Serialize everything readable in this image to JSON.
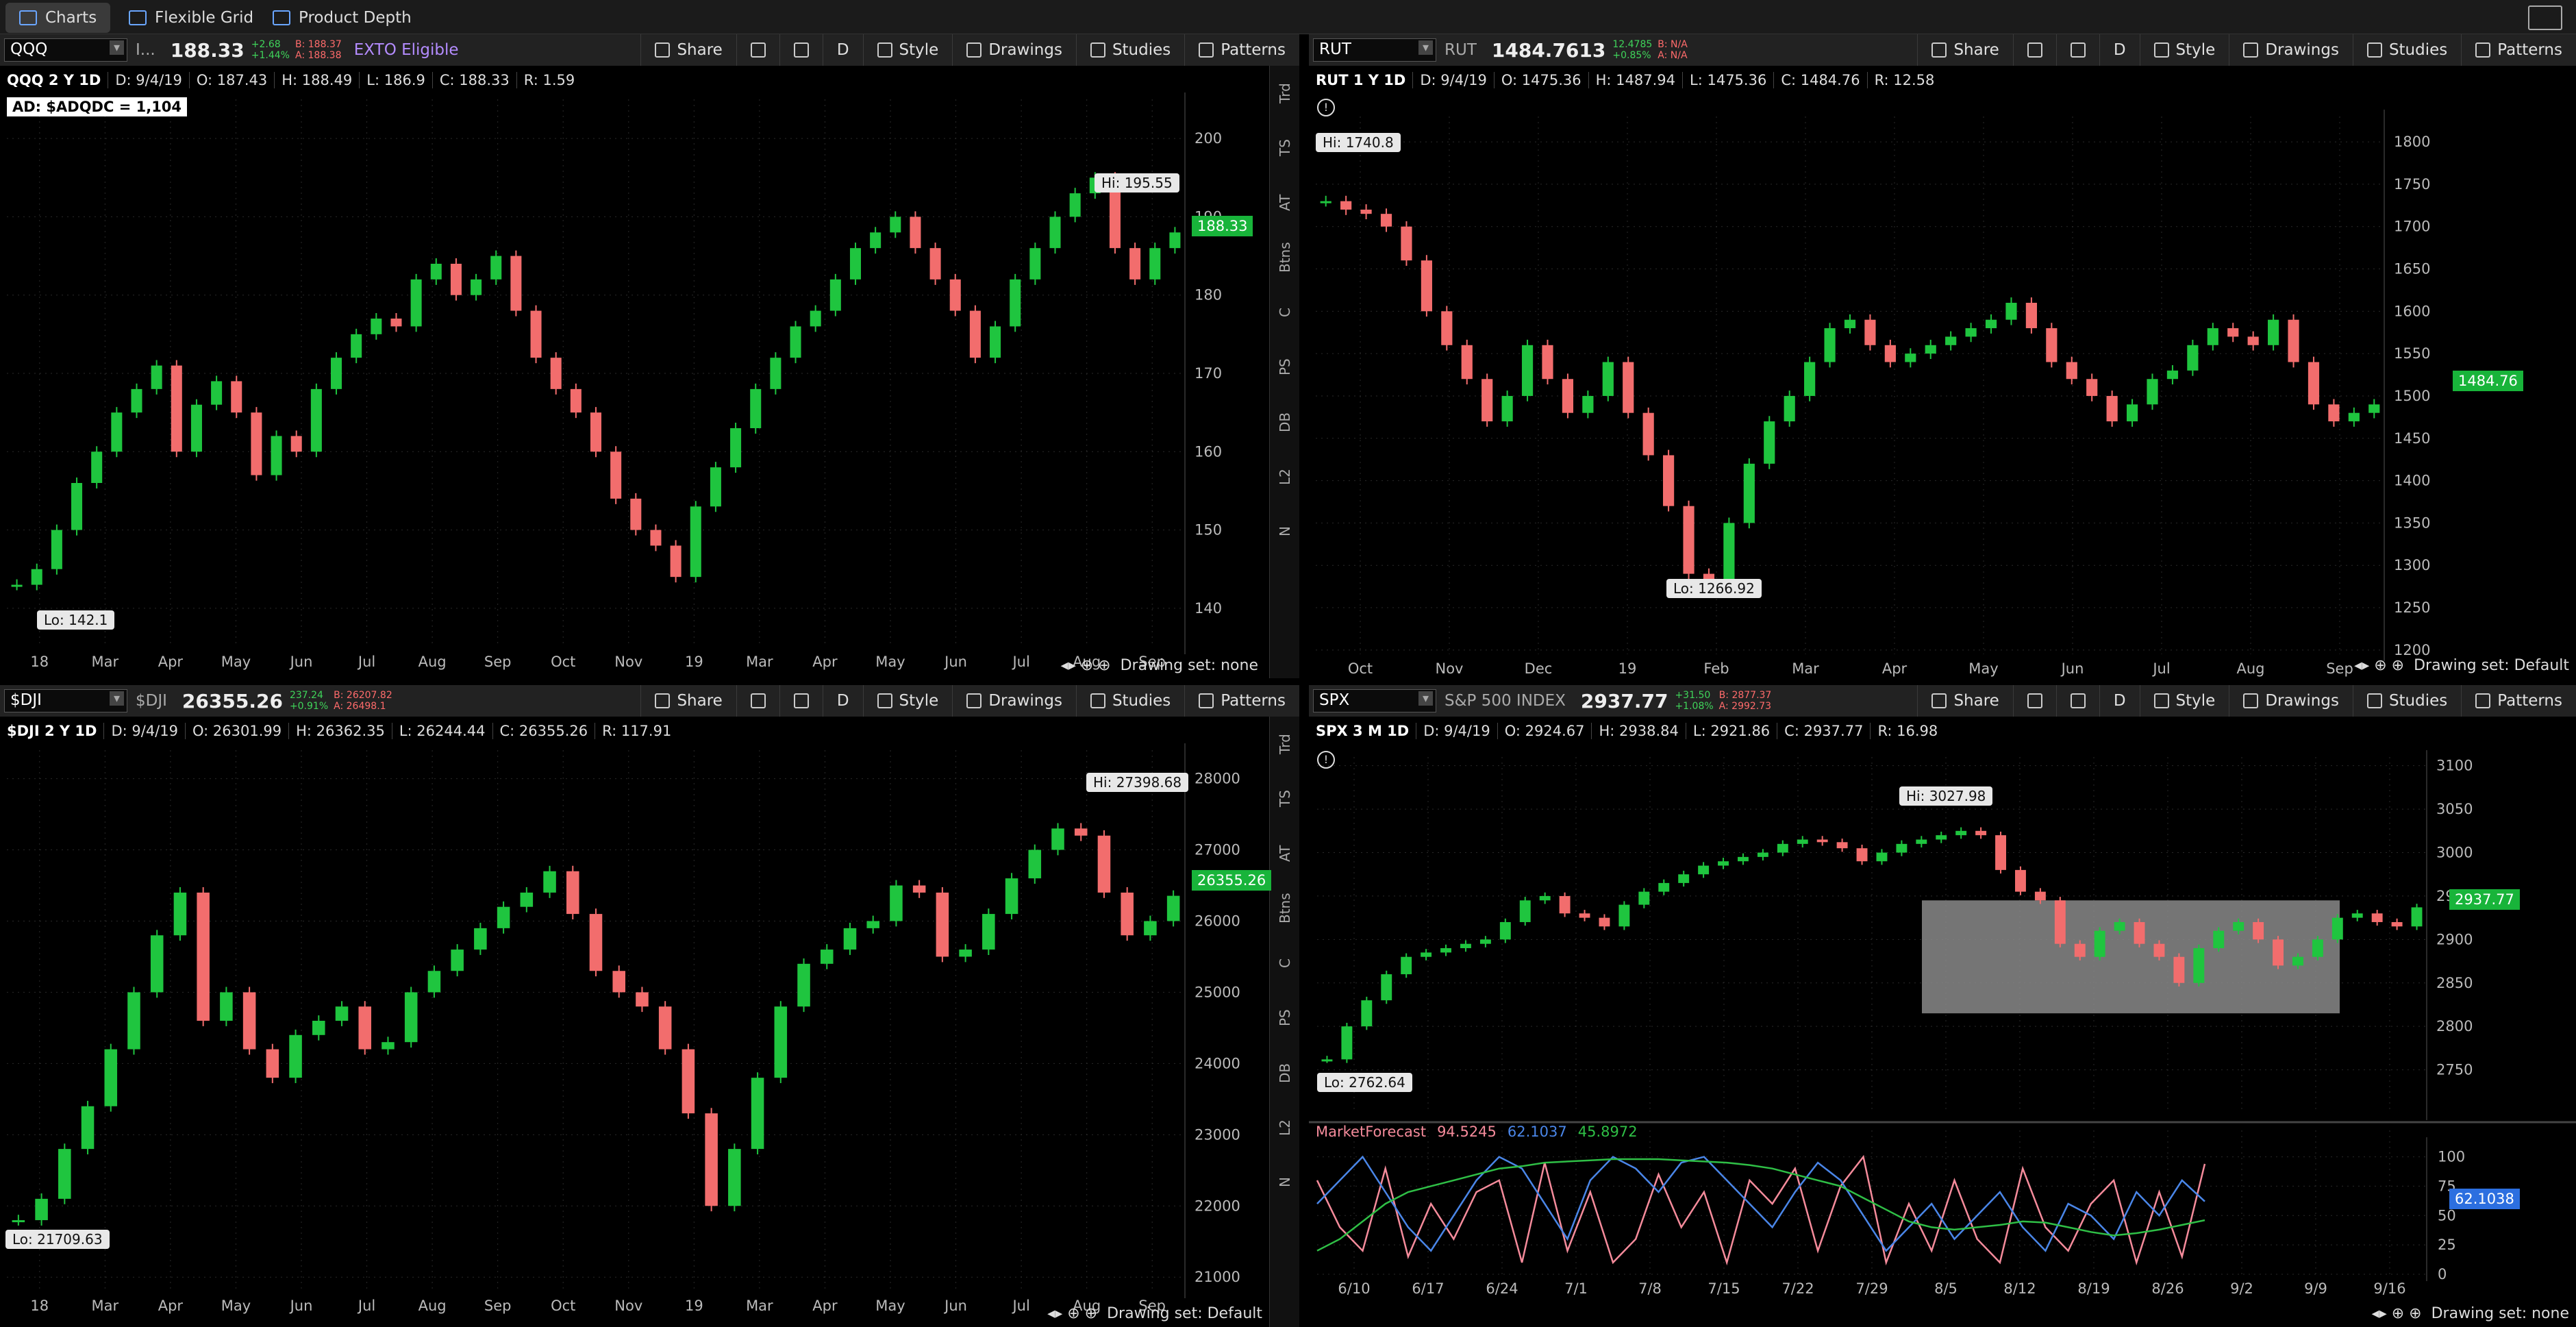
{
  "app": {
    "tabs": [
      {
        "label": "Charts",
        "icon": "chart-icon"
      },
      {
        "label": "Flexible Grid",
        "icon": "grid-icon"
      },
      {
        "label": "Product Depth",
        "icon": "depth-icon"
      }
    ]
  },
  "toolbar_labels": {
    "share": "Share",
    "style": "Style",
    "drawings": "Drawings",
    "studies": "Studies",
    "patterns": "Patterns",
    "period": "D"
  },
  "side_buttons": [
    "Trd",
    "TS",
    "AT",
    "Btns",
    "C",
    "PS",
    "DB",
    "L2",
    "N"
  ],
  "panels": [
    {
      "id": "qqq",
      "symbol": "QQQ",
      "desc": "I...",
      "last": "188.33",
      "chg": "+2.68",
      "chg_pct": "+1.44%",
      "bid": "B: 188.37",
      "ask": "A: 188.38",
      "exto": "EXTO Eligible",
      "title": "QQQ 2 Y 1D",
      "date": "D: 9/4/19",
      "open": "O: 187.43",
      "high": "H: 188.49",
      "low": "L: 186.9",
      "close": "C: 188.33",
      "range": "R: 1.59",
      "ad_label": "AD: $ADQDC = 1,104",
      "hi_label": "Hi: 195.55",
      "lo_label": "Lo: 142.1",
      "price_box": "188.33",
      "drawing_set": "Drawing set: none"
    },
    {
      "id": "rut",
      "symbol": "RUT",
      "desc": "RUT",
      "last": "1484.7613",
      "chg": "12.4785",
      "chg_pct": "+0.85%",
      "bid": "B: N/A",
      "ask": "A: N/A",
      "title": "RUT 1 Y 1D",
      "date": "D: 9/4/19",
      "open": "O: 1475.36",
      "high": "H: 1487.94",
      "low": "L: 1475.36",
      "close": "C: 1484.76",
      "range": "R: 12.58",
      "hi_label": "Hi: 1740.8",
      "lo_label": "Lo: 1266.92",
      "price_box": "1484.76",
      "drawing_set": "Drawing set: Default"
    },
    {
      "id": "dji",
      "symbol": "$DJI",
      "desc": "$DJI",
      "last": "26355.26",
      "chg": "237.24",
      "chg_pct": "+0.91%",
      "bid": "B: 26207.82",
      "ask": "A: 26498.1",
      "title": "$DJI 2 Y 1D",
      "date": "D: 9/4/19",
      "open": "O: 26301.99",
      "high": "H: 26362.35",
      "low": "L: 26244.44",
      "close": "C: 26355.26",
      "range": "R: 117.91",
      "hi_label": "Hi: 27398.68",
      "lo_label": "Lo: 21709.63",
      "price_box": "26355.26",
      "drawing_set": "Drawing set: Default"
    },
    {
      "id": "spx",
      "symbol": "SPX",
      "desc": "S&P 500 INDEX",
      "last": "2937.77",
      "chg": "+31.50",
      "chg_pct": "+1.08%",
      "bid": "B: 2877.37",
      "ask": "A: 2992.73",
      "title": "SPX 3 M 1D",
      "date": "D: 9/4/19",
      "open": "O: 2924.67",
      "high": "H: 2938.84",
      "low": "L: 2921.86",
      "close": "C: 2937.77",
      "range": "R: 16.98",
      "hi_label": "Hi: 3027.98",
      "lo_label": "Lo: 2762.64",
      "price_box": "2937.77",
      "drawing_set": "Drawing set: none",
      "study_name": "MarketForecast",
      "study_v1": "94.5245",
      "study_v2": "62.1037",
      "study_v3": "45.8972",
      "study_box": "62.1038"
    }
  ],
  "colors": {
    "up": "#1fc53f",
    "down": "#f26d6d",
    "bg": "#000000",
    "toolbar": "#222222",
    "accent": "#18b43a"
  },
  "chart_data": [
    {
      "type": "candlestick",
      "title": "QQQ 2 Y 1D",
      "x": [
        "18",
        "Mar",
        "Apr",
        "May",
        "Jun",
        "Jul",
        "Aug",
        "Sep",
        "Oct",
        "Nov",
        "19",
        "Mar",
        "Apr",
        "May",
        "Jun",
        "Jul",
        "Aug",
        "Sep"
      ],
      "ylim": [
        135,
        205
      ],
      "yticks": [
        140,
        150,
        160,
        170,
        180,
        190,
        200
      ],
      "series": [
        {
          "values": [
            143,
            145,
            150,
            156,
            160,
            165,
            168,
            171,
            160,
            166,
            169,
            165,
            157,
            162,
            160,
            168,
            172,
            175,
            177,
            176,
            182,
            184,
            180,
            182,
            185,
            178,
            172,
            168,
            165,
            160,
            154,
            150,
            148,
            144,
            153,
            158,
            163,
            168,
            172,
            176,
            178,
            182,
            186,
            188,
            190,
            186,
            182,
            178,
            172,
            176,
            182,
            186,
            190,
            193,
            195,
            186,
            182,
            186,
            188
          ]
        }
      ]
    },
    {
      "type": "candlestick",
      "title": "RUT 1 Y 1D",
      "x": [
        "Oct",
        "Nov",
        "Dec",
        "19",
        "Feb",
        "Mar",
        "Apr",
        "May",
        "Jun",
        "Jul",
        "Aug",
        "Sep"
      ],
      "ylim": [
        1195,
        1830
      ],
      "yticks": [
        1200,
        1250,
        1300,
        1350,
        1400,
        1450,
        1500,
        1550,
        1600,
        1650,
        1700,
        1750,
        1800
      ],
      "series": [
        {
          "values": [
            1730,
            1720,
            1715,
            1700,
            1660,
            1600,
            1560,
            1520,
            1470,
            1500,
            1560,
            1520,
            1480,
            1500,
            1540,
            1480,
            1430,
            1370,
            1290,
            1270,
            1350,
            1420,
            1470,
            1500,
            1540,
            1580,
            1590,
            1560,
            1540,
            1550,
            1560,
            1570,
            1580,
            1590,
            1610,
            1580,
            1540,
            1520,
            1500,
            1470,
            1490,
            1520,
            1530,
            1560,
            1580,
            1570,
            1560,
            1590,
            1540,
            1490,
            1470,
            1480,
            1490
          ]
        }
      ]
    },
    {
      "type": "candlestick",
      "title": "$DJI 2 Y 1D",
      "x": [
        "18",
        "Mar",
        "Apr",
        "May",
        "Jun",
        "Jul",
        "Aug",
        "Sep",
        "Oct",
        "Nov",
        "19",
        "Mar",
        "Apr",
        "May",
        "Jun",
        "Jul",
        "Aug",
        "Sep"
      ],
      "ylim": [
        20800,
        28400
      ],
      "yticks": [
        21000,
        22000,
        23000,
        24000,
        25000,
        26000,
        27000,
        28000
      ],
      "series": [
        {
          "values": [
            21800,
            22100,
            22800,
            23400,
            24200,
            25000,
            25800,
            26400,
            24600,
            25000,
            24200,
            23800,
            24400,
            24600,
            24800,
            24200,
            24300,
            25000,
            25300,
            25600,
            25900,
            26200,
            26400,
            26700,
            26100,
            25300,
            25000,
            24800,
            24200,
            23300,
            22000,
            22800,
            23800,
            24800,
            25400,
            25600,
            25900,
            26000,
            26500,
            26400,
            25500,
            25600,
            26100,
            26600,
            27000,
            27300,
            27200,
            26400,
            25800,
            26000,
            26355
          ]
        }
      ]
    },
    {
      "type": "candlestick",
      "title": "SPX 3 M 1D",
      "x": [
        "6/10",
        "6/17",
        "6/24",
        "7/1",
        "7/8",
        "7/15",
        "7/22",
        "7/29",
        "8/5",
        "8/12",
        "8/19",
        "8/26",
        "9/2",
        "9/9",
        "9/16"
      ],
      "ylim": [
        2700,
        3110
      ],
      "yticks": [
        2750,
        2800,
        2850,
        2900,
        2950,
        3000,
        3050,
        3100
      ],
      "series": [
        {
          "values": [
            2762,
            2800,
            2830,
            2860,
            2880,
            2885,
            2890,
            2895,
            2900,
            2920,
            2945,
            2950,
            2930,
            2925,
            2915,
            2940,
            2955,
            2965,
            2975,
            2985,
            2990,
            2995,
            3000,
            3010,
            3015,
            3012,
            3005,
            2990,
            3000,
            3010,
            3015,
            3020,
            3025,
            3020,
            2980,
            2955,
            2945,
            2895,
            2880,
            2910,
            2920,
            2895,
            2880,
            2850,
            2890,
            2910,
            2920,
            2900,
            2870,
            2880,
            2900,
            2925,
            2930,
            2920,
            2915,
            2937
          ]
        }
      ],
      "forecast_box": {
        "from": "8/5",
        "to": "9/9",
        "low": 2815,
        "high": 2945
      }
    },
    {
      "type": "line",
      "title": "MarketForecast",
      "x": [
        "6/10",
        "6/17",
        "6/24",
        "7/1",
        "7/8",
        "7/15",
        "7/22",
        "7/29",
        "8/5",
        "8/12",
        "8/19",
        "8/26",
        "9/2",
        "9/9",
        "9/16"
      ],
      "ylim": [
        0,
        105
      ],
      "yticks": [
        0,
        25,
        50,
        75,
        100
      ],
      "series": [
        {
          "name": "MarketForecast",
          "color": "#f58b9b",
          "values": [
            80,
            40,
            20,
            90,
            15,
            60,
            30,
            70,
            80,
            10,
            95,
            20,
            70,
            10,
            30,
            85,
            40,
            70,
            10,
            80,
            60,
            90,
            20,
            75,
            100,
            10,
            60,
            20,
            80,
            30,
            10,
            90,
            40,
            20,
            60,
            80,
            10,
            70,
            15,
            94
          ]
        },
        {
          "name": "62.1037",
          "color": "#4a86e8",
          "values": [
            60,
            80,
            100,
            70,
            40,
            20,
            50,
            80,
            100,
            90,
            60,
            30,
            80,
            100,
            90,
            70,
            95,
            100,
            80,
            60,
            40,
            70,
            95,
            80,
            50,
            20,
            40,
            60,
            30,
            50,
            70,
            40,
            20,
            60,
            50,
            30,
            70,
            50,
            80,
            62
          ]
        },
        {
          "name": "45.8972",
          "color": "#2fbf46",
          "values": [
            20,
            30,
            45,
            60,
            70,
            75,
            80,
            85,
            90,
            92,
            95,
            96,
            97,
            98,
            98,
            98,
            97,
            96,
            95,
            93,
            90,
            85,
            80,
            75,
            65,
            55,
            45,
            40,
            38,
            40,
            42,
            45,
            44,
            40,
            36,
            33,
            35,
            38,
            42,
            46
          ]
        }
      ]
    }
  ]
}
